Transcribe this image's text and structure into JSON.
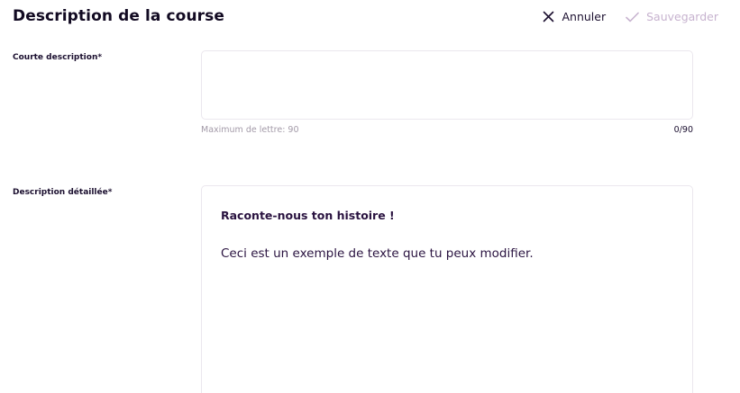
{
  "header": {
    "title": "Description de la course",
    "cancel_label": "Annuler",
    "save_label": "Sauvegarder",
    "cancel_icon": "close-icon",
    "save_icon": "check-icon"
  },
  "short_description": {
    "label": "Courte description*",
    "value": "",
    "hint": "Maximum de lettre: 90",
    "counter": "0/90"
  },
  "detailed_description": {
    "label": "Description détaillée*",
    "heading": "Raconte-nous ton histoire !",
    "body": "Ceci est un exemple de texte que tu peux modifier."
  },
  "colors": {
    "text": "#1c1030",
    "save_disabled": "#c7b3cf",
    "hint": "#a39aa8",
    "border": "#ebe7ee"
  }
}
